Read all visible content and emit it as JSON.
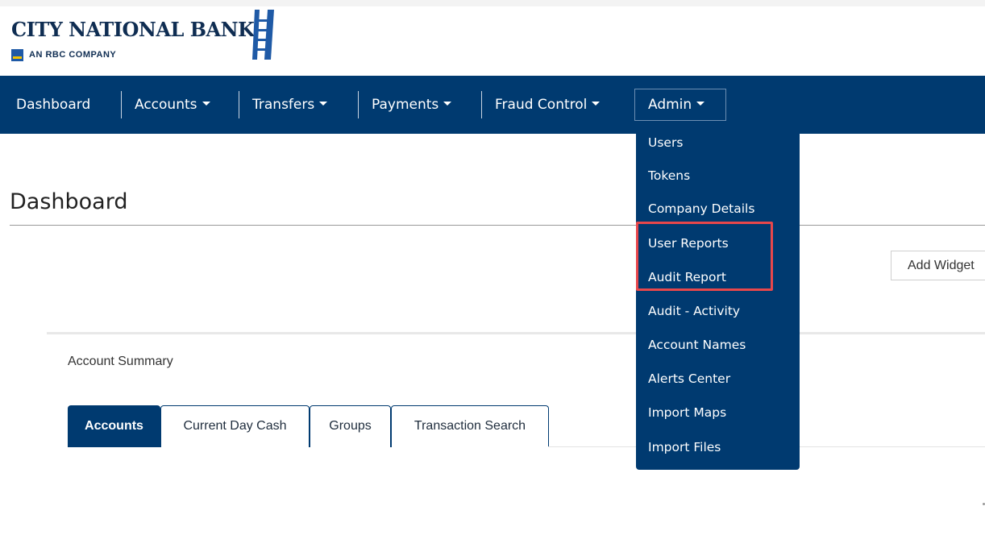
{
  "brand": {
    "name": "City National Bank",
    "name_display": "CITY NATIONAL BANK",
    "subtitle": "AN RBC COMPANY"
  },
  "nav": {
    "items": [
      {
        "label": "Dashboard"
      },
      {
        "label": "Accounts"
      },
      {
        "label": "Transfers"
      },
      {
        "label": "Payments"
      },
      {
        "label": "Fraud Control"
      },
      {
        "label": "Admin"
      }
    ],
    "open_menu": "Admin"
  },
  "admin_menu": {
    "items": [
      {
        "label": "Users"
      },
      {
        "label": "Tokens"
      },
      {
        "label": "Company Details"
      },
      {
        "label": "User Reports"
      },
      {
        "label": "Audit Report"
      },
      {
        "label": "Audit - Activity"
      },
      {
        "label": "Account Names"
      },
      {
        "label": "Alerts Center"
      },
      {
        "label": "Import Maps"
      },
      {
        "label": "Import Files"
      }
    ],
    "highlighted": [
      "User Reports",
      "Audit Report"
    ]
  },
  "page": {
    "title": "Dashboard",
    "add_widget_label": "Add Widget"
  },
  "widget": {
    "title": "Account Summary",
    "tabs": [
      {
        "label": "Accounts",
        "active": true
      },
      {
        "label": "Current Day Cash",
        "active": false
      },
      {
        "label": "Groups",
        "active": false
      },
      {
        "label": "Transaction Search",
        "active": false
      }
    ]
  },
  "colors": {
    "brand_navy": "#003a70",
    "highlight_red": "#e8474b",
    "logo_text": "#0f2d52"
  }
}
